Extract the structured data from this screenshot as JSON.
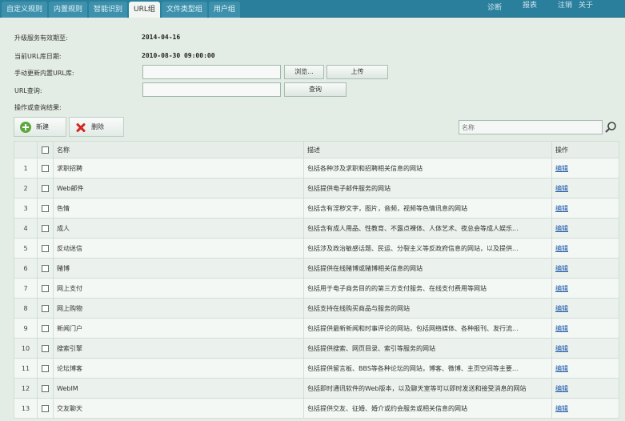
{
  "nav": {
    "tabs": [
      {
        "label": "自定义规则",
        "active": false
      },
      {
        "label": "内置规则",
        "active": false
      },
      {
        "label": "智能识别",
        "active": false
      },
      {
        "label": "URL组",
        "active": true
      },
      {
        "label": "文件类型组",
        "active": false
      },
      {
        "label": "用户组",
        "active": false
      }
    ],
    "links": [
      "诊断",
      "报表",
      "注销",
      "关于"
    ]
  },
  "form": {
    "expiry_label": "升级服务有效期至:",
    "expiry_value": "2014-04-16",
    "db_date_label": "当前URL库日期:",
    "db_date_value": "2010-08-30 09:00:00",
    "manual_update_label": "手动更新内置URL库:",
    "manual_update_value": "",
    "browse_label": "浏览...",
    "upload_label": "上传",
    "url_query_label": "URL查询:",
    "url_query_value": "",
    "query_button_label": "查询",
    "results_label": "操作或查询结果:"
  },
  "toolbar": {
    "new_label": "新建",
    "delete_label": "删除",
    "search_placeholder": "名称"
  },
  "table": {
    "headers": {
      "name": "名称",
      "desc": "描述",
      "action": "操作"
    },
    "rows": [
      {
        "num": "1",
        "name": "求职招聘",
        "desc": "包括各种涉及求职和招聘相关信息的网站",
        "action": "编辑"
      },
      {
        "num": "2",
        "name": "Web邮件",
        "desc": "包括提供电子邮件服务的网站",
        "action": "编辑"
      },
      {
        "num": "3",
        "name": "色情",
        "desc": "包括含有淫秽文字，图片，音频，视频等色情讯息的网站",
        "action": "编辑"
      },
      {
        "num": "4",
        "name": "成人",
        "desc": "包括含有成人用品、性教育、不露点裸体、人体艺术、夜总会等成人娱乐...",
        "action": "编辑"
      },
      {
        "num": "5",
        "name": "反动迷信",
        "desc": "包括涉及政治敏感话题、民运、分裂主义等反政府信息的网站，以及提供...",
        "action": "编辑"
      },
      {
        "num": "6",
        "name": "赌博",
        "desc": "包括提供在线赌博或赌博相关信息的网站",
        "action": "编辑"
      },
      {
        "num": "7",
        "name": "网上支付",
        "desc": "包括用于电子商务目的的第三方支付服务、在线支付费用等网站",
        "action": "编辑"
      },
      {
        "num": "8",
        "name": "网上购物",
        "desc": "包括支持在线购买商品与服务的网站",
        "action": "编辑"
      },
      {
        "num": "9",
        "name": "新闻门户",
        "desc": "包括提供最新新闻和时事评论的网站，包括网络媒体、各种报刊、发行流...",
        "action": "编辑"
      },
      {
        "num": "10",
        "name": "搜索引擎",
        "desc": "包括提供搜索、网页目录、索引等服务的网站",
        "action": "编辑"
      },
      {
        "num": "11",
        "name": "论坛博客",
        "desc": "包括提供留言板、BBS等各种论坛的网站，博客、微博、主页空间等主要...",
        "action": "编辑"
      },
      {
        "num": "12",
        "name": "WebIM",
        "desc": "包括即时通讯软件的Web版本，以及聊天室等可以即时发送和接受消息的网站",
        "action": "编辑"
      },
      {
        "num": "13",
        "name": "交友聊天",
        "desc": "包括提供交友、征婚、婚介或约会服务或相关信息的网站",
        "action": "编辑"
      }
    ]
  }
}
